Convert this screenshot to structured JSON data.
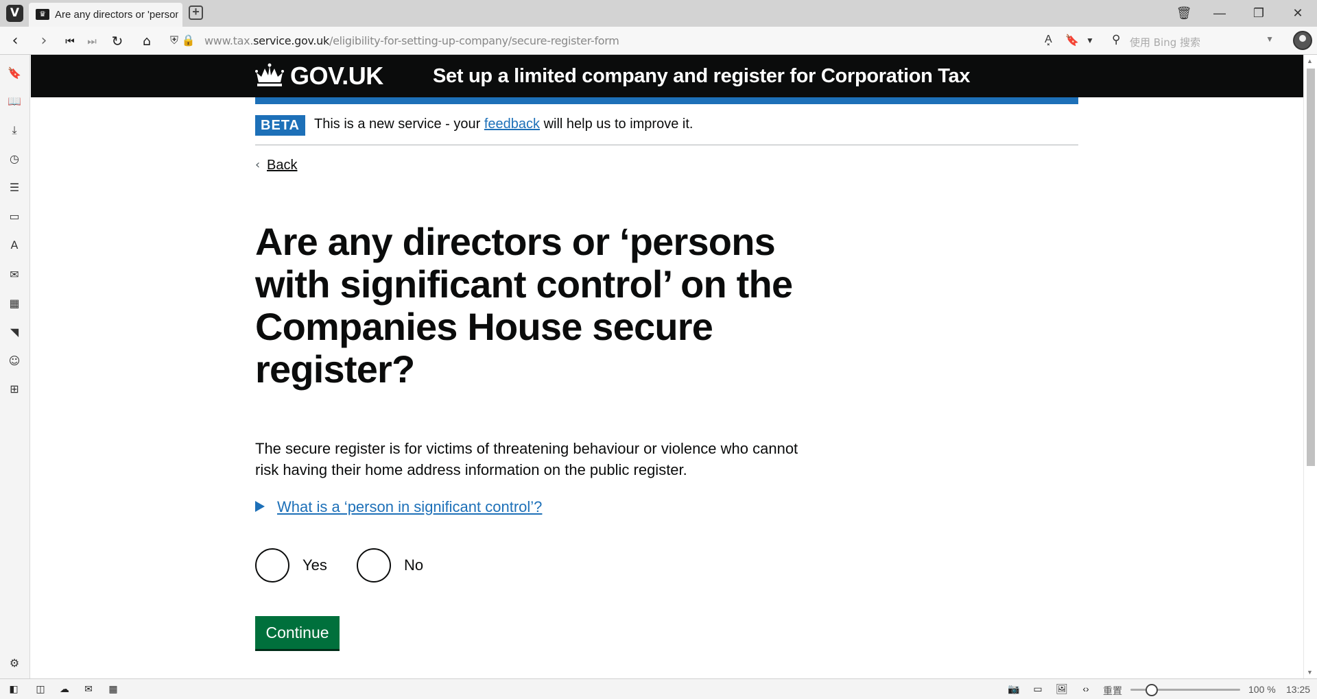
{
  "browser": {
    "tab_title": "Are any directors or 'persons",
    "new_tab_icon": "plus-icon",
    "url_prefix": "www.tax.",
    "url_host": "service.gov.uk",
    "url_path": "/eligibility-for-setting-up-company/secure-register-form",
    "search_placeholder": "使用 Bing 搜索",
    "app_icon": "V"
  },
  "header": {
    "logo_text": "GOV.UK",
    "service_name": "Set up a limited company and register for Corporation Tax"
  },
  "phase_banner": {
    "tag": "BETA",
    "text_before": "This is a new service - your ",
    "link_text": "feedback",
    "text_after": " will help us to improve it."
  },
  "back_link": {
    "label": "Back"
  },
  "question": {
    "heading": "Are any directors or ‘persons with significant control’ on the Companies House secure register?",
    "hint": "The secure register is for victims of threatening behaviour or violence who cannot risk having their home address information on the public register.",
    "details_summary": "What is a ‘person in significant control’?",
    "options": [
      {
        "label": "Yes",
        "selected": false
      },
      {
        "label": "No",
        "selected": false
      }
    ],
    "continue_label": "Continue"
  },
  "status_bar": {
    "reset_label": "重置",
    "zoom_level": "100 %",
    "clock": "13:25"
  },
  "colors": {
    "header_bg": "#0b0c0c",
    "brand_blue": "#1d70b8",
    "button_green": "#00703c"
  }
}
